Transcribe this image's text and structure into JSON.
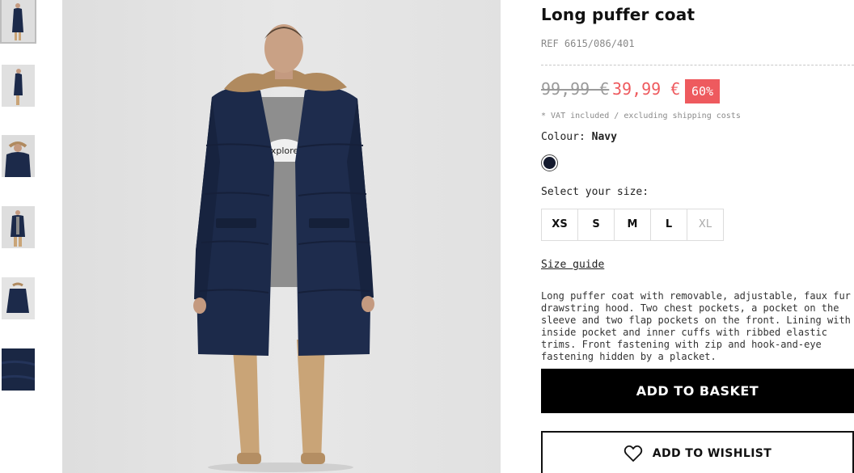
{
  "product": {
    "title": "Long puffer coat",
    "ref": "REF 6615/086/401",
    "old_price": "99,99 €",
    "new_price": "39,99 €",
    "discount": "60%",
    "vat_note": "* VAT included / excluding shipping costs",
    "colour_label": "Colour:",
    "colour_value": "Navy",
    "swatch_color": "#141a2e",
    "size_label": "Select your size:",
    "sizes": [
      {
        "label": "XS",
        "available": true
      },
      {
        "label": "S",
        "available": true
      },
      {
        "label": "M",
        "available": true
      },
      {
        "label": "L",
        "available": true
      },
      {
        "label": "XL",
        "available": false
      }
    ],
    "size_guide": "Size guide",
    "description": "Long puffer coat with removable, adjustable, faux fur drawstring hood. Two chest pockets, a pocket on the sleeve and two flap pockets on the front. Lining with inside pocket and inner cuffs with ribbed elastic trims. Front fastening with zip and hook-and-eye fastening hidden by a placket.",
    "add_to_basket": "ADD TO BASKET",
    "add_to_wishlist": "ADD TO WISHLIST"
  },
  "gallery": {
    "thumbnail_count": 6,
    "selected_index": 0
  },
  "colors": {
    "sale_red": "#ee5a5e",
    "coat_navy": "#1c2a4a",
    "button_black": "#000000"
  },
  "icons": {
    "wishlist": "heart-icon"
  }
}
